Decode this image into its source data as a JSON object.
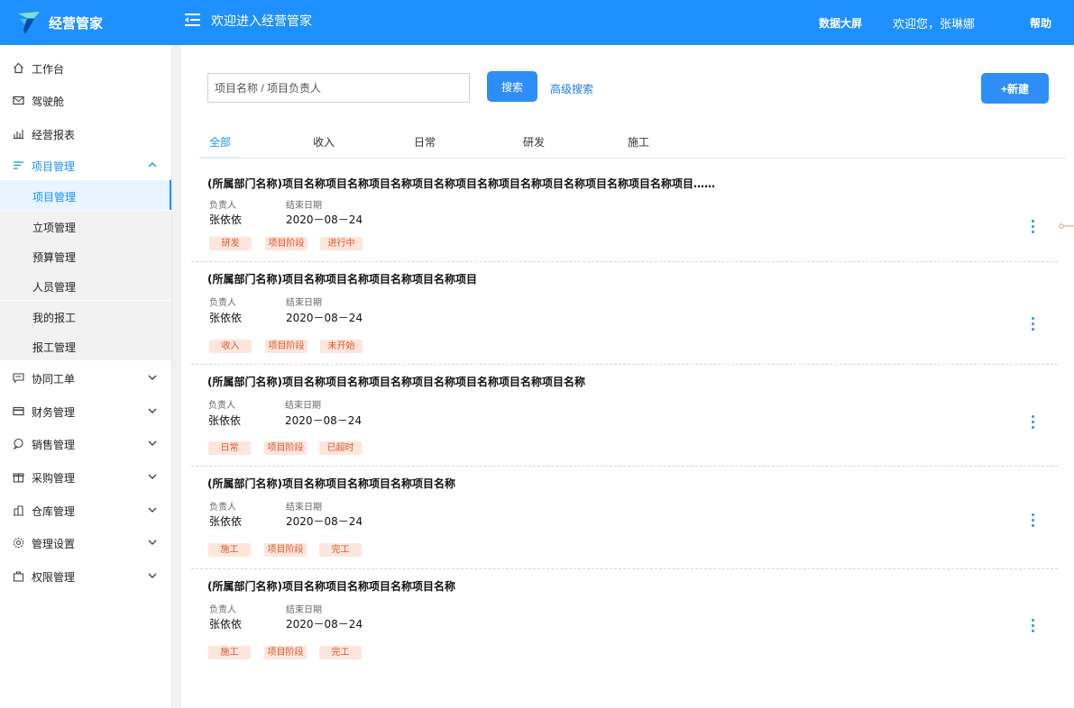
{
  "header": {
    "app_name": "经营管家",
    "welcome": "欢迎进入经营管家",
    "data_screen": "数据大屏",
    "user_greeting": "欢迎您，张琳娜",
    "help": "帮助",
    "brand_color": "#1e90ff"
  },
  "sidebar": {
    "items": [
      {
        "label": "工作台",
        "icon": "home-icon"
      },
      {
        "label": "驾驶舱",
        "icon": "mail-icon"
      },
      {
        "label": "经营报表",
        "icon": "bar-chart-icon"
      },
      {
        "label": "项目管理",
        "icon": "list-icon",
        "expanded": true,
        "children": [
          "项目管理",
          "立项管理",
          "预算管理",
          "人员管理",
          "我的报工",
          "报工管理"
        ],
        "active_child": "项目管理"
      },
      {
        "label": "协同工单",
        "icon": "message-icon"
      },
      {
        "label": "财务管理",
        "icon": "card-icon"
      },
      {
        "label": "销售管理",
        "icon": "chat-icon"
      },
      {
        "label": "采购管理",
        "icon": "gift-icon"
      },
      {
        "label": "仓库管理",
        "icon": "warehouse-icon"
      },
      {
        "label": "管理设置",
        "icon": "gear-icon"
      },
      {
        "label": "权限管理",
        "icon": "bag-icon"
      }
    ]
  },
  "search": {
    "placeholder": "项目名称 / 项目负责人",
    "button": "搜索",
    "advanced": "高级搜索",
    "new_button": "+新建"
  },
  "tabs": [
    "全部",
    "收入",
    "日常",
    "研发",
    "施工"
  ],
  "active_tab": "全部",
  "list": {
    "owner_label": "负责人",
    "date_label": "结束日期",
    "items": [
      {
        "title": "(所属部门名称)项目名称项目名称项目名称项目名称项目名称项目名称项目名称项目名称项目名称项目……",
        "owner": "张依依",
        "end_date": "2020－08－24",
        "tags": [
          "研发",
          "项目阶段",
          "进行中"
        ]
      },
      {
        "title": "(所属部门名称)项目名称项目名称项目名称项目名称项目",
        "owner": "张依依",
        "end_date": "2020－08－24",
        "tags": [
          "收入",
          "项目阶段",
          "未开始"
        ]
      },
      {
        "title": "(所属部门名称)项目名称项目名称项目名称项目名称项目名称项目名称项目名称",
        "owner": "张依依",
        "end_date": "2020－08－24",
        "tags": [
          "日常",
          "项目阶段",
          "已超时"
        ]
      },
      {
        "title": "(所属部门名称)项目名称项目名称项目名称项目名称",
        "owner": "张依依",
        "end_date": "2020－08－24",
        "tags": [
          "施工",
          "项目阶段",
          "完工"
        ]
      },
      {
        "title": "(所属部门名称)项目名称项目名称项目名称项目名称",
        "owner": "张依依",
        "end_date": "2020－08－24",
        "tags": [
          "施工",
          "项目阶段",
          "完工"
        ]
      }
    ]
  }
}
